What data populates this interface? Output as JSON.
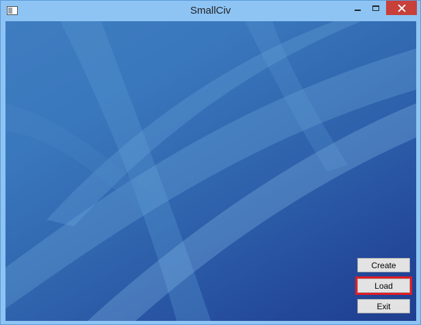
{
  "window": {
    "title": "SmallCiv",
    "controls": {
      "minimize": "minimize-icon",
      "maximize": "maximize-icon",
      "close": "close-icon",
      "close_color": "#c7403a"
    }
  },
  "menu": {
    "create_label": "Create",
    "load_label": "Load",
    "exit_label": "Exit"
  },
  "highlight": {
    "target": "load",
    "color": "#e21b23"
  }
}
